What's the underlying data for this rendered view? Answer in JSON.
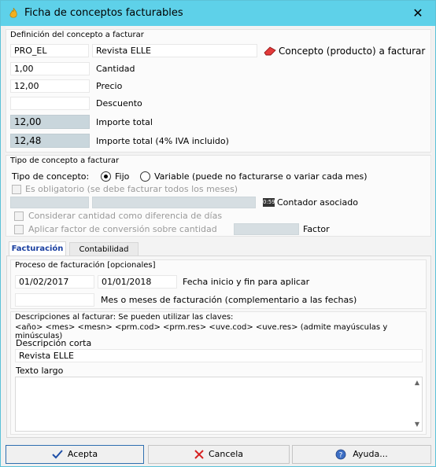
{
  "window": {
    "title": "Ficha de conceptos facturables",
    "close_glyph": "✕"
  },
  "definicion": {
    "title": "Definición del concepto a facturar",
    "code_value": "PRO_EL",
    "name_value": "Revista ELLE",
    "concepto_label": "Concepto (producto) a facturar",
    "cantidad_value": "1,00",
    "cantidad_label": "Cantidad",
    "precio_value": "12,00",
    "precio_label": "Precio",
    "descuento_value": "",
    "descuento_label": "Descuento",
    "importe_value": "12,00",
    "importe_label": "Importe total",
    "importe_iva_value": "12,48",
    "importe_iva_label": "Importe total (4% IVA incluido)"
  },
  "tipo": {
    "title": "Tipo de concepto a facturar",
    "tipo_label": "Tipo de concepto:",
    "fijo_label": "Fijo",
    "variable_label": "Variable (puede no facturarse o variar cada mes)",
    "selected": "fijo",
    "obligatorio_label": "Es obligatorio (se debe facturar todos los meses)",
    "contador_label": "Contador asociado",
    "contador_icon_text": "0:59",
    "considerar_label": "Considerar cantidad como diferencia de días",
    "aplicar_label": "Aplicar factor de conversión sobre cantidad",
    "factor_label": "Factor"
  },
  "tabs": [
    {
      "label": "Facturación",
      "active": true
    },
    {
      "label": "Contabilidad",
      "active": false
    }
  ],
  "proceso": {
    "title": "Proceso de facturación [opcionales]",
    "fecha_inicio": "01/02/2017",
    "fecha_fin": "01/01/2018",
    "fechas_label": "Fecha inicio y fin para aplicar",
    "meses_value": "",
    "meses_label": "Mes o meses de facturación (complementario a las fechas)"
  },
  "descripciones": {
    "title": "Descripciones al facturar: Se pueden utilizar las claves:",
    "keys_line": "<año> <mes> <mesn> <prm.cod> <prm.res> <uve.cod> <uve.res> (admite mayúsculas y minúsculas)",
    "corta_label": "Descripción corta",
    "corta_value": "Revista ELLE",
    "largo_label": "Texto largo",
    "largo_value": ""
  },
  "buttons": {
    "acepta": "Acepta",
    "cancela": "Cancela",
    "ayuda": "Ayuda..."
  },
  "colors": {
    "titlebar": "#5ed1e9",
    "accent_tab": "#1a3fa0",
    "readonly_field": "#c9d6dc"
  }
}
